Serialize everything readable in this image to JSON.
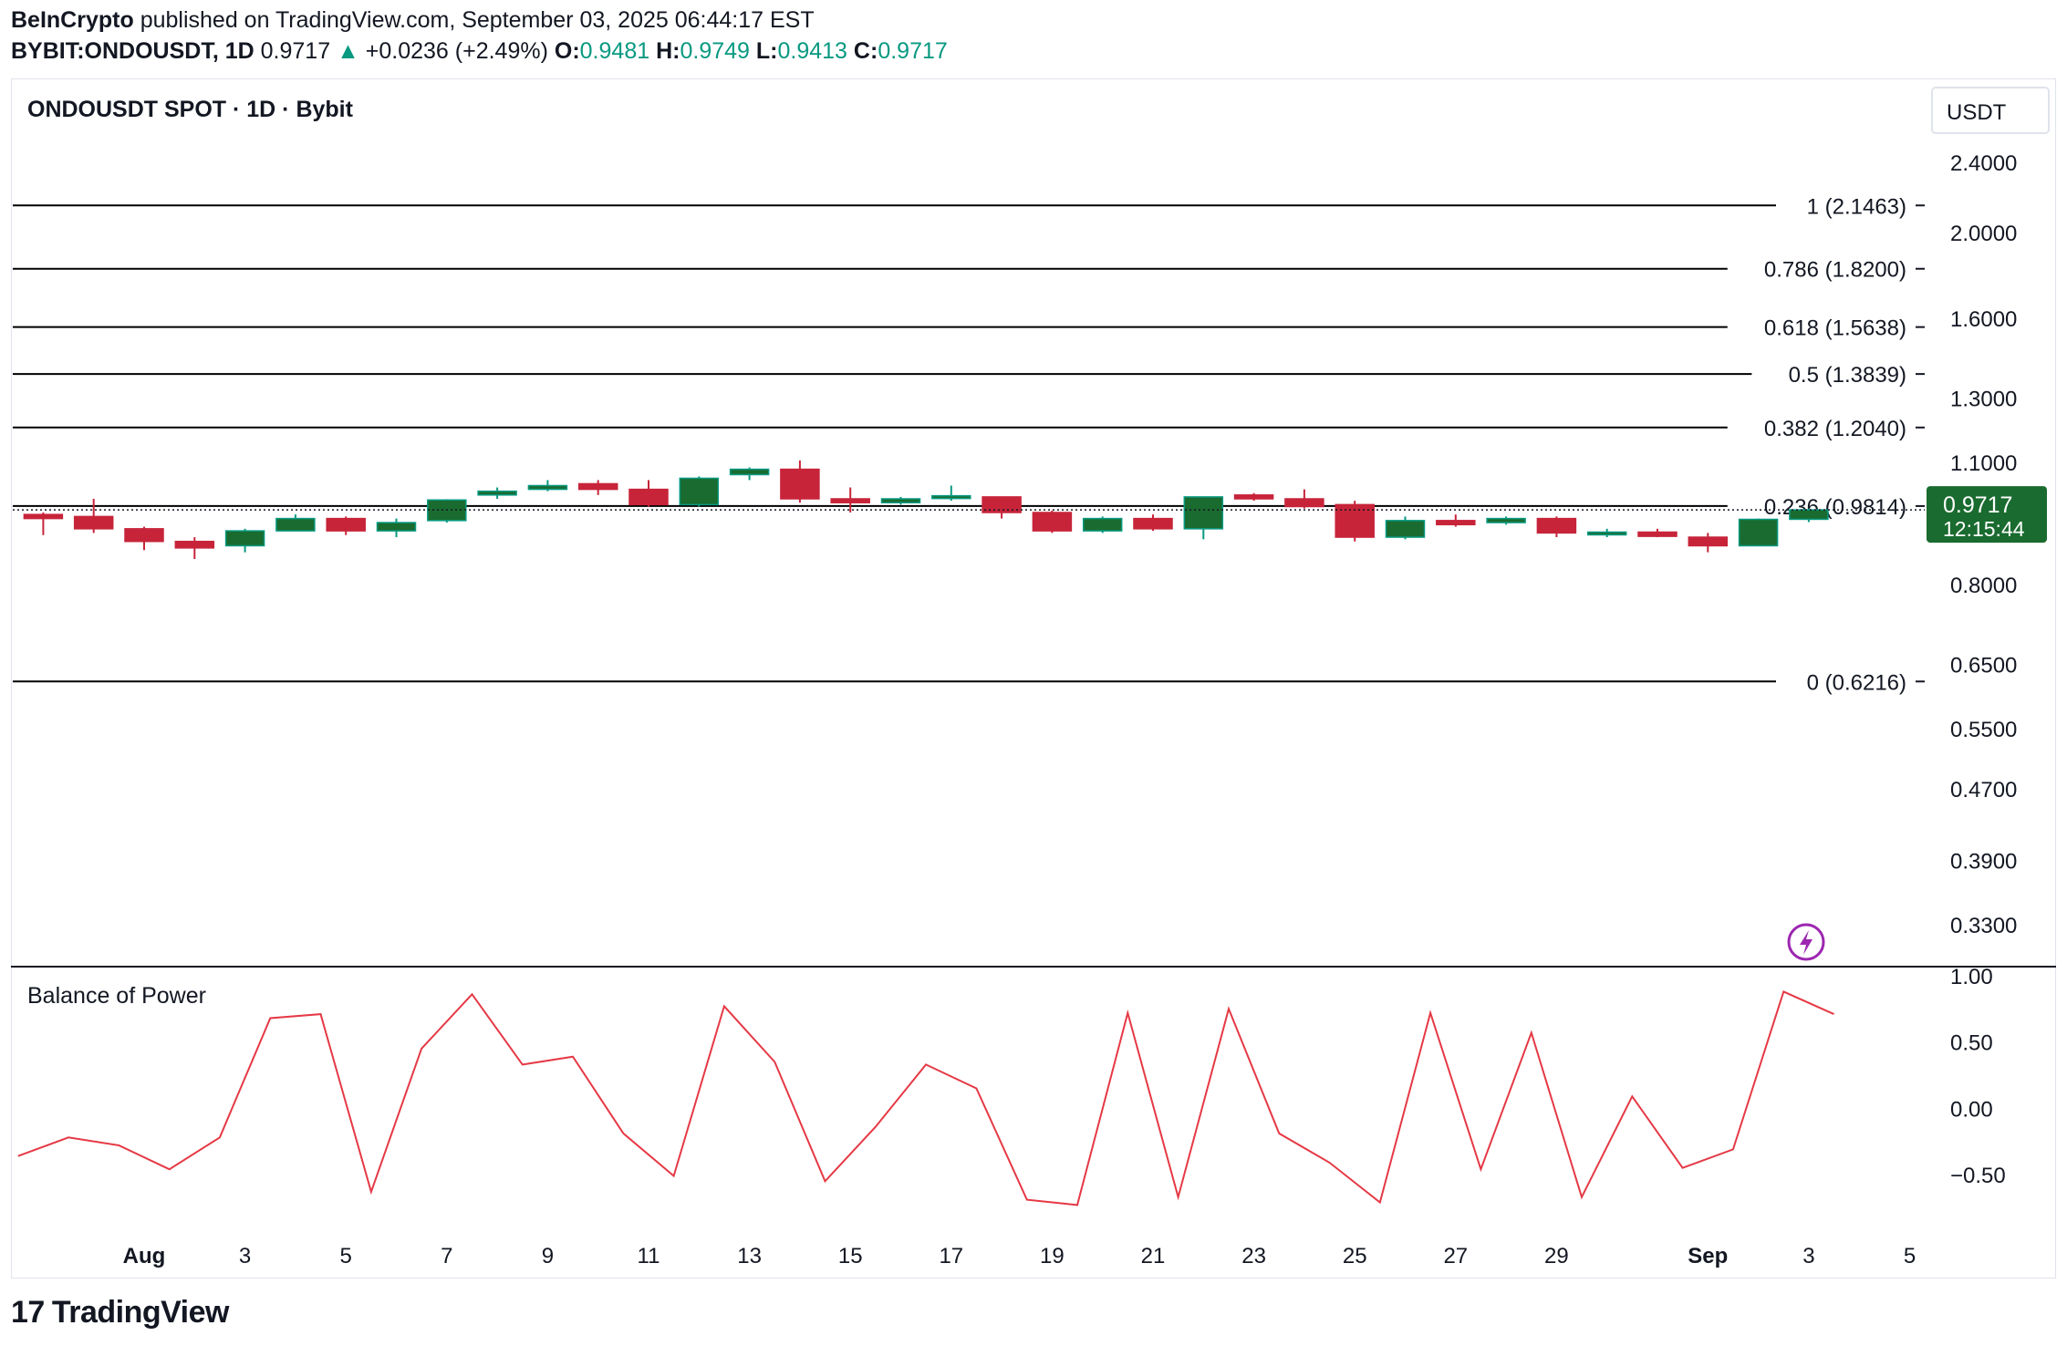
{
  "header": {
    "publisher": "BeInCrypto",
    "published_text": "published on TradingView.com, September 03, 2025 06:44:17 EST",
    "symbol": "BYBIT:ONDOUSDT, 1D",
    "last": "0.9717",
    "arrow": "▲",
    "change": "+0.0236 (+2.49%)",
    "o_label": "O:",
    "o_value": "0.9481",
    "h_label": "H:",
    "h_value": "0.9749",
    "l_label": "L:",
    "l_value": "0.9413",
    "c_label": "C:",
    "c_value": "0.9717"
  },
  "branding": {
    "logo_mark": "17",
    "logo_text": "TradingView"
  },
  "colors": {
    "up": "#1a6b2f",
    "up_wick": "#089981",
    "down": "#c7243a",
    "down_wick": "#c7243a",
    "fib": "#000000",
    "bop": "#e53945",
    "price_tag": "#1a6b2f",
    "bolt": "#9c27b0"
  },
  "chart_data": [
    {
      "type": "candlestick",
      "title": "ONDOUSDT SPOT · 1D · Bybit",
      "currency": "USDT",
      "scale": "log",
      "ylim": [
        0.3,
        2.6
      ],
      "y_ticks": [
        {
          "value": 2.4,
          "label": "2.4000"
        },
        {
          "value": 2.0,
          "label": "2.0000"
        },
        {
          "value": 1.6,
          "label": "1.6000"
        },
        {
          "value": 1.3,
          "label": "1.3000"
        },
        {
          "value": 1.1,
          "label": "1.1000"
        },
        {
          "value": 0.8,
          "label": "0.8000"
        },
        {
          "value": 0.65,
          "label": "0.6500"
        },
        {
          "value": 0.55,
          "label": "0.5500"
        },
        {
          "value": 0.47,
          "label": "0.4700"
        },
        {
          "value": 0.39,
          "label": "0.3900"
        },
        {
          "value": 0.33,
          "label": "0.3300"
        }
      ],
      "fib_levels": [
        {
          "value": 2.1463,
          "label": "1 (2.1463)"
        },
        {
          "value": 1.82,
          "label": "0.786 (1.8200)"
        },
        {
          "value": 1.5638,
          "label": "0.618 (1.5638)"
        },
        {
          "value": 1.3839,
          "label": "0.5 (1.3839)"
        },
        {
          "value": 1.204,
          "label": "0.382 (1.2040)"
        },
        {
          "value": 0.9814,
          "label": "0.236 (0.9814)"
        },
        {
          "value": 0.6216,
          "label": "0 (0.6216)"
        }
      ],
      "current_price": {
        "value": 0.9717,
        "label": "0.9717",
        "countdown": "12:15:44"
      },
      "x_ticks": [
        {
          "day": 1,
          "label": "Aug",
          "bold": true
        },
        {
          "day": 3,
          "label": "3"
        },
        {
          "day": 5,
          "label": "5"
        },
        {
          "day": 7,
          "label": "7"
        },
        {
          "day": 9,
          "label": "9"
        },
        {
          "day": 11,
          "label": "11"
        },
        {
          "day": 13,
          "label": "13"
        },
        {
          "day": 15,
          "label": "15"
        },
        {
          "day": 17,
          "label": "17"
        },
        {
          "day": 19,
          "label": "19"
        },
        {
          "day": 21,
          "label": "21"
        },
        {
          "day": 23,
          "label": "23"
        },
        {
          "day": 25,
          "label": "25"
        },
        {
          "day": 27,
          "label": "27"
        },
        {
          "day": 29,
          "label": "29"
        },
        {
          "day": 32,
          "label": "Sep",
          "bold": true
        },
        {
          "day": 34,
          "label": "3"
        },
        {
          "day": 36,
          "label": "5"
        }
      ],
      "candles": [
        {
          "date": "2025-07-30",
          "o": 0.96,
          "h": 0.965,
          "l": 0.91,
          "c": 0.95
        },
        {
          "date": "2025-07-31",
          "o": 0.955,
          "h": 1.0,
          "l": 0.915,
          "c": 0.925
        },
        {
          "date": "2025-08-01",
          "o": 0.925,
          "h": 0.93,
          "l": 0.875,
          "c": 0.895
        },
        {
          "date": "2025-08-02",
          "o": 0.895,
          "h": 0.905,
          "l": 0.855,
          "c": 0.88
        },
        {
          "date": "2025-08-03",
          "o": 0.885,
          "h": 0.925,
          "l": 0.87,
          "c": 0.92
        },
        {
          "date": "2025-08-04",
          "o": 0.92,
          "h": 0.96,
          "l": 0.92,
          "c": 0.95
        },
        {
          "date": "2025-08-05",
          "o": 0.95,
          "h": 0.955,
          "l": 0.91,
          "c": 0.92
        },
        {
          "date": "2025-08-06",
          "o": 0.92,
          "h": 0.95,
          "l": 0.905,
          "c": 0.94
        },
        {
          "date": "2025-08-07",
          "o": 0.945,
          "h": 0.999,
          "l": 0.94,
          "c": 0.997
        },
        {
          "date": "2025-08-08",
          "o": 1.01,
          "h": 1.03,
          "l": 1.0,
          "c": 1.02
        },
        {
          "date": "2025-08-09",
          "o": 1.025,
          "h": 1.05,
          "l": 1.02,
          "c": 1.035
        },
        {
          "date": "2025-08-10",
          "o": 1.04,
          "h": 1.05,
          "l": 1.01,
          "c": 1.025
        },
        {
          "date": "2025-08-11",
          "o": 1.025,
          "h": 1.05,
          "l": 0.98,
          "c": 0.985
        },
        {
          "date": "2025-08-12",
          "o": 0.985,
          "h": 1.06,
          "l": 0.98,
          "c": 1.055
        },
        {
          "date": "2025-08-13",
          "o": 1.065,
          "h": 1.085,
          "l": 1.05,
          "c": 1.08
        },
        {
          "date": "2025-08-14",
          "o": 1.08,
          "h": 1.105,
          "l": 0.99,
          "c": 1.0
        },
        {
          "date": "2025-08-15",
          "o": 1.0,
          "h": 1.03,
          "l": 0.965,
          "c": 0.99
        },
        {
          "date": "2025-08-16",
          "o": 0.99,
          "h": 1.005,
          "l": 0.985,
          "c": 1.0
        },
        {
          "date": "2025-08-17",
          "o": 1.002,
          "h": 1.035,
          "l": 0.995,
          "c": 1.008
        },
        {
          "date": "2025-08-18",
          "o": 1.005,
          "h": 1.005,
          "l": 0.95,
          "c": 0.965
        },
        {
          "date": "2025-08-19",
          "o": 0.965,
          "h": 0.97,
          "l": 0.915,
          "c": 0.92
        },
        {
          "date": "2025-08-20",
          "o": 0.92,
          "h": 0.955,
          "l": 0.915,
          "c": 0.95
        },
        {
          "date": "2025-08-21",
          "o": 0.95,
          "h": 0.96,
          "l": 0.92,
          "c": 0.925
        },
        {
          "date": "2025-08-22",
          "o": 0.925,
          "h": 1.005,
          "l": 0.9,
          "c": 1.005
        },
        {
          "date": "2025-08-23",
          "o": 1.01,
          "h": 1.015,
          "l": 0.995,
          "c": 1.0
        },
        {
          "date": "2025-08-24",
          "o": 1.0,
          "h": 1.025,
          "l": 0.975,
          "c": 0.98
        },
        {
          "date": "2025-08-25",
          "o": 0.985,
          "h": 0.995,
          "l": 0.895,
          "c": 0.905
        },
        {
          "date": "2025-08-26",
          "o": 0.905,
          "h": 0.955,
          "l": 0.9,
          "c": 0.945
        },
        {
          "date": "2025-08-27",
          "o": 0.945,
          "h": 0.96,
          "l": 0.93,
          "c": 0.935
        },
        {
          "date": "2025-08-28",
          "o": 0.94,
          "h": 0.955,
          "l": 0.935,
          "c": 0.95
        },
        {
          "date": "2025-08-29",
          "o": 0.95,
          "h": 0.955,
          "l": 0.905,
          "c": 0.915
        },
        {
          "date": "2025-08-30",
          "o": 0.915,
          "h": 0.925,
          "l": 0.905,
          "c": 0.917
        },
        {
          "date": "2025-08-31",
          "o": 0.917,
          "h": 0.925,
          "l": 0.905,
          "c": 0.907
        },
        {
          "date": "2025-09-01",
          "o": 0.905,
          "h": 0.915,
          "l": 0.87,
          "c": 0.885
        },
        {
          "date": "2025-09-02",
          "o": 0.885,
          "h": 0.95,
          "l": 0.885,
          "c": 0.948
        },
        {
          "date": "2025-09-03",
          "o": 0.9481,
          "h": 0.9749,
          "l": 0.9413,
          "c": 0.9717
        }
      ]
    },
    {
      "type": "line",
      "title": "Balance of Power",
      "ylim": [
        -0.95,
        1.0
      ],
      "y_ticks": [
        {
          "value": 1.0,
          "label": "1.00"
        },
        {
          "value": 0.5,
          "label": "0.50"
        },
        {
          "value": 0.0,
          "label": "0.00"
        },
        {
          "value": -0.5,
          "label": "−0.50"
        }
      ],
      "start_day": -1.5,
      "values": [
        -0.36,
        -0.22,
        -0.28,
        -0.46,
        -0.22,
        0.68,
        0.71,
        -0.63,
        0.45,
        0.86,
        0.33,
        0.39,
        -0.19,
        -0.51,
        0.77,
        0.35,
        -0.55,
        -0.14,
        0.33,
        0.15,
        -0.69,
        -0.73,
        0.72,
        -0.67,
        0.75,
        -0.19,
        -0.41,
        -0.71,
        0.72,
        -0.46,
        0.57,
        -0.67,
        0.09,
        -0.45,
        -0.31,
        0.88,
        0.71
      ]
    }
  ]
}
